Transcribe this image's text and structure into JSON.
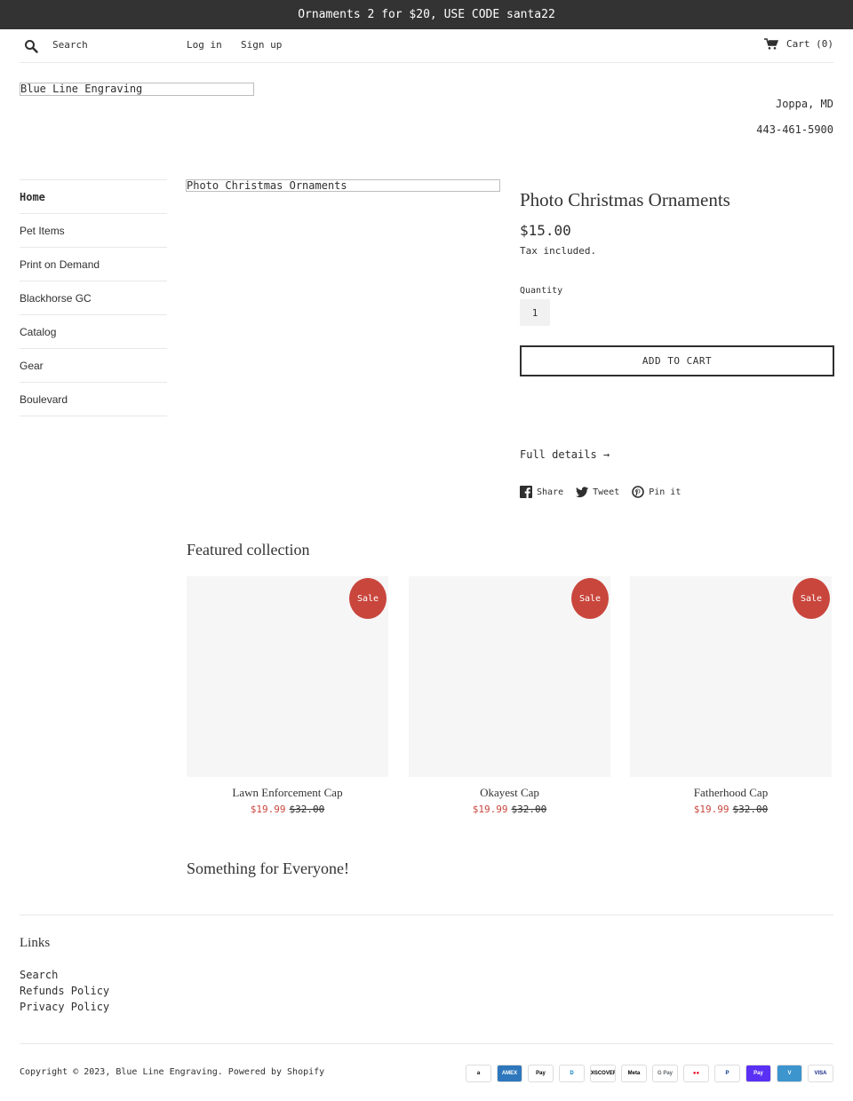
{
  "announcement": "Ornaments 2 for $20, USE CODE santa22",
  "header": {
    "search_label": "Search",
    "login_label": "Log in",
    "signup_label": "Sign up",
    "cart_label": "Cart (0)"
  },
  "store": {
    "logo_alt": "Blue Line Engraving",
    "location": "Joppa, MD",
    "phone": "443-461-5900"
  },
  "sidebar": {
    "items": [
      {
        "label": "Home"
      },
      {
        "label": "Pet Items"
      },
      {
        "label": "Print on Demand"
      },
      {
        "label": "Blackhorse GC"
      },
      {
        "label": "Catalog"
      },
      {
        "label": "Gear"
      },
      {
        "label": "Boulevard"
      }
    ]
  },
  "product": {
    "image_alt": "Photo Christmas Ornaments",
    "title": "Photo Christmas Ornaments",
    "price": "$15.00",
    "tax_note": "Tax included.",
    "quantity_label": "Quantity",
    "quantity_value": "1",
    "add_to_cart_label": "ADD TO CART",
    "full_details_label": "Full details →",
    "share": {
      "facebook": "Share",
      "twitter": "Tweet",
      "pinterest": "Pin it"
    }
  },
  "featured": {
    "title": "Featured collection",
    "sale_badge": "Sale",
    "items": [
      {
        "title": "Lawn Enforcement Cap",
        "sale_price": "$19.99",
        "original_price": "$32.00"
      },
      {
        "title": "Okayest Cap",
        "sale_price": "$19.99",
        "original_price": "$32.00"
      },
      {
        "title": "Fatherhood Cap",
        "sale_price": "$19.99",
        "original_price": "$32.00"
      }
    ]
  },
  "section_heading": "Something for Everyone!",
  "footer": {
    "links_title": "Links",
    "links": [
      "Search",
      "Refunds Policy",
      "Privacy Policy"
    ],
    "copyright": "Copyright © 2023, Blue Line Engraving. Powered by Shopify",
    "payment_icons": [
      {
        "name": "amazon-icon",
        "label": "a",
        "color": "#000000",
        "bg": "#ffffff"
      },
      {
        "name": "amex-icon",
        "label": "AMEX",
        "color": "#ffffff",
        "bg": "#2e77bc"
      },
      {
        "name": "apple-pay-icon",
        "label": "Pay",
        "color": "#000000",
        "bg": "#ffffff"
      },
      {
        "name": "diners-club-icon",
        "label": "D",
        "color": "#0079be",
        "bg": "#ffffff"
      },
      {
        "name": "discover-icon",
        "label": "DISCOVER",
        "color": "#000000",
        "bg": "#ffffff"
      },
      {
        "name": "meta-pay-icon",
        "label": "Meta",
        "color": "#000000",
        "bg": "#ffffff"
      },
      {
        "name": "google-pay-icon",
        "label": "G Pay",
        "color": "#5f6368",
        "bg": "#ffffff"
      },
      {
        "name": "mastercard-icon",
        "label": "●●",
        "color": "#eb001b",
        "bg": "#ffffff"
      },
      {
        "name": "paypal-icon",
        "label": "P",
        "color": "#003087",
        "bg": "#ffffff"
      },
      {
        "name": "shop-pay-icon",
        "label": "Pay",
        "color": "#ffffff",
        "bg": "#5a31f4"
      },
      {
        "name": "venmo-icon",
        "label": "V",
        "color": "#ffffff",
        "bg": "#3d95ce"
      },
      {
        "name": "visa-icon",
        "label": "VISA",
        "color": "#142688",
        "bg": "#ffffff"
      }
    ]
  },
  "colors": {
    "announcement_bg": "#333333",
    "sale_red": "#c9463d",
    "text": "#2f2f2f"
  }
}
